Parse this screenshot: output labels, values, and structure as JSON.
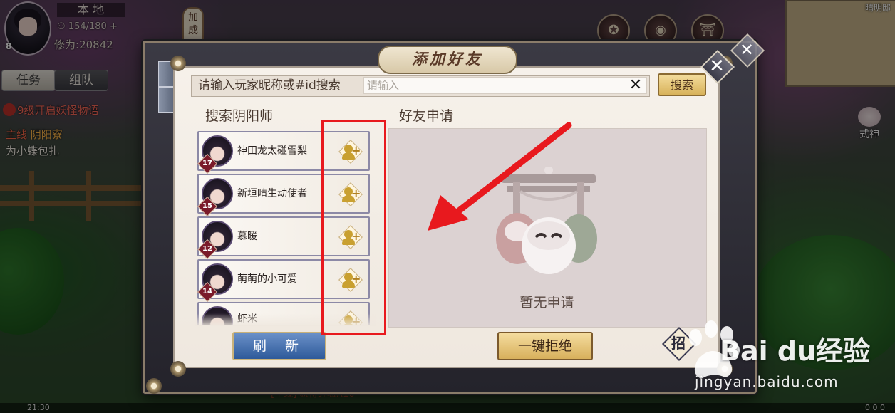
{
  "hud": {
    "server": "本 地",
    "player_level": "8",
    "stamina": "154/180",
    "power_label": "修为:",
    "power_value": "20842",
    "join_label": "加成",
    "tabs": [
      "任务",
      "组队"
    ],
    "quest_alert": "9级开启妖怪物语",
    "quest_main_tag": "主线",
    "quest_main_title": "阴阳寮",
    "quest_sub": "为小蝶包扎",
    "minimap_label": "晴明邸",
    "shikigami_label": "式神",
    "bottom_quest": "[主线] 获得经验X10",
    "time": "21:30",
    "bottom_counts": "0   0   0"
  },
  "dialog": {
    "title": "添加好友",
    "search_label": "请输入玩家昵称或#id搜索",
    "search_placeholder": "请输入",
    "search_button": "搜索",
    "left_heading": "搜索阴阳师",
    "right_heading": "好友申请",
    "empty_text": "暂无申请",
    "refresh_button": "刷 新",
    "reject_all_button": "一键拒绝",
    "invite_button": "招",
    "results": [
      {
        "name": "神田龙太碰雪梨",
        "level": "17"
      },
      {
        "name": "新垣晴生动使者",
        "level": "15"
      },
      {
        "name": "慕暖",
        "level": "12"
      },
      {
        "name": "萌萌的小可爱",
        "level": "14"
      },
      {
        "name": "虾米",
        "level": ""
      }
    ]
  },
  "watermark": {
    "brand": "Bai du经验",
    "url": "jingyan.baidu.com"
  },
  "colors": {
    "highlight": "#e8191e",
    "gold_button": "#d8b25a",
    "blue_button": "#2e5a9a"
  }
}
